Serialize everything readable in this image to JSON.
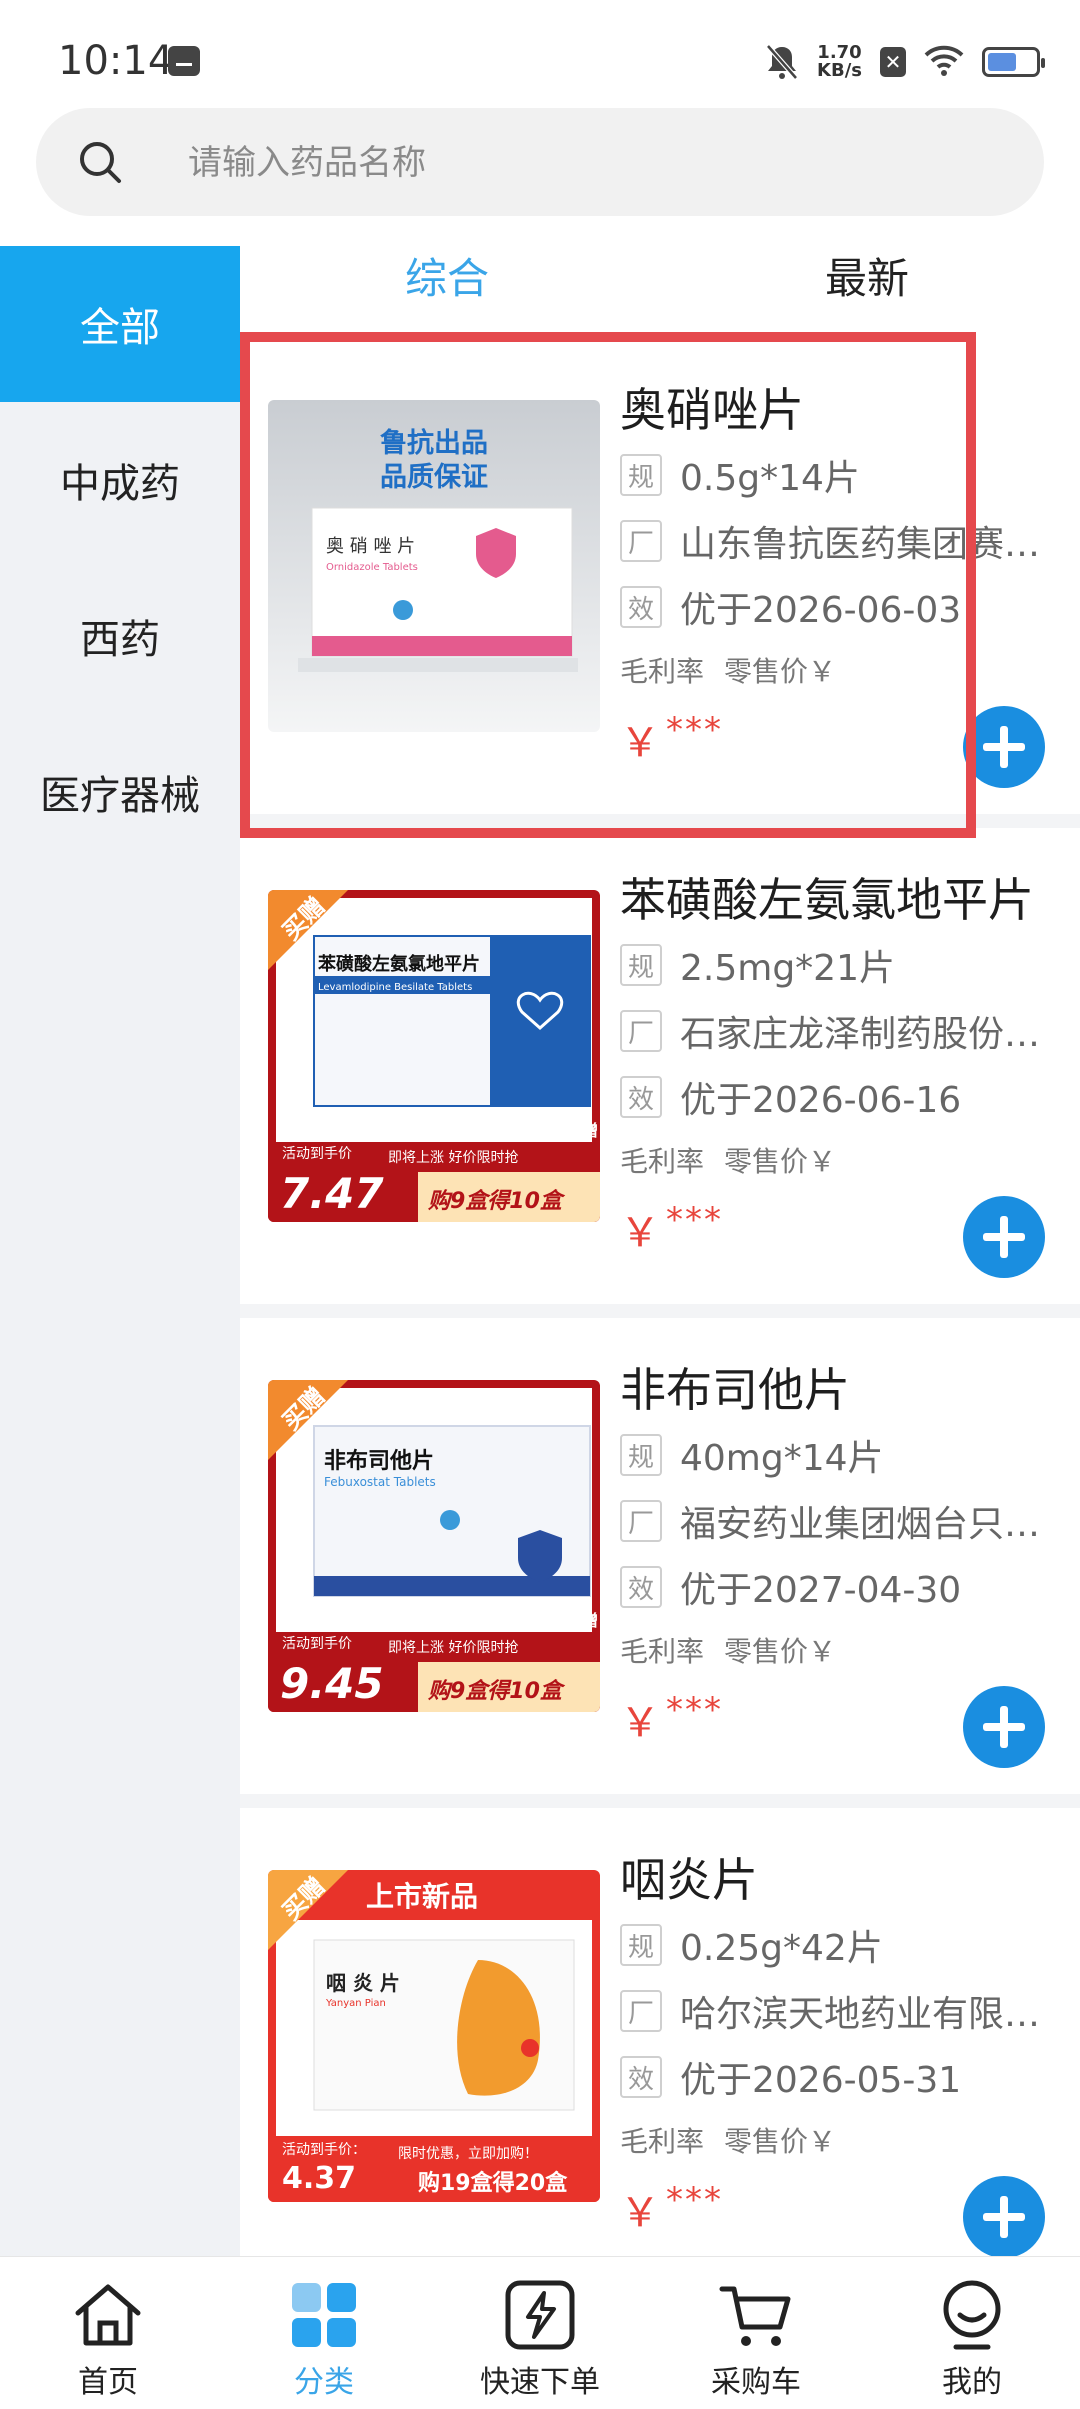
{
  "status_bar": {
    "time": "10:14",
    "net_speed_value": "1.70",
    "net_speed_unit": "KB/s",
    "icons": [
      "message-icon",
      "bell-off-icon",
      "close-box-icon",
      "wifi-icon",
      "battery-icon"
    ]
  },
  "search": {
    "placeholder": "请输入药品名称"
  },
  "sidebar": {
    "items": [
      {
        "label": "全部",
        "active": true
      },
      {
        "label": "中成药",
        "active": false
      },
      {
        "label": "西药",
        "active": false
      },
      {
        "label": "医疗器械",
        "active": false
      }
    ]
  },
  "sort_tabs": [
    {
      "label": "综合",
      "active": true
    },
    {
      "label": "最新",
      "active": false
    }
  ],
  "row_tags": {
    "spec": "规",
    "maker": "厂",
    "expiry": "效"
  },
  "products": [
    {
      "name": "奥硝唑片",
      "spec": "0.5g*14片",
      "manufacturer": "山东鲁抗医药集团赛…",
      "expiry": "优于2026-06-03",
      "margin_label": "毛利率",
      "retail_label": "零售价￥",
      "price_symbol": "￥",
      "price_hidden": "***",
      "image": {
        "banner1": "鲁抗出品",
        "banner2": "品质保证",
        "box_title": "奥 硝 唑 片",
        "box_en": "Ornidazole Tablets"
      }
    },
    {
      "name": "苯磺酸左氨氯地平片",
      "spec": "2.5mg*21片",
      "manufacturer": "石家庄龙泽制药股份…",
      "expiry": "优于2026-06-16",
      "margin_label": "毛利率",
      "retail_label": "零售价￥",
      "price_symbol": "￥",
      "price_hidden": "***",
      "image": {
        "ribbon": "买赠",
        "box_title": "苯磺酸左氨氯地平片",
        "box_en": "Levamlodipine Besilate Tablets",
        "promo_label": "活动到手价",
        "promo_price": "7.47",
        "promo_note": "即将上涨 好价限时抢",
        "gift": "满赠",
        "deal": "购9盒得10盒"
      }
    },
    {
      "name": "非布司他片",
      "spec": "40mg*14片",
      "manufacturer": "福安药业集团烟台只…",
      "expiry": "优于2027-04-30",
      "margin_label": "毛利率",
      "retail_label": "零售价￥",
      "price_symbol": "￥",
      "price_hidden": "***",
      "image": {
        "ribbon": "买赠",
        "box_title": "非布司他片",
        "box_en": "Febuxostat Tablets",
        "promo_label": "活动到手价",
        "promo_price": "9.45",
        "promo_note": "即将上涨 好价限时抢",
        "gift": "满赠",
        "deal": "购9盒得10盒"
      }
    },
    {
      "name": "咽炎片",
      "spec": "0.25g*42片",
      "manufacturer": "哈尔滨天地药业有限…",
      "expiry": "优于2026-05-31",
      "margin_label": "毛利率",
      "retail_label": "零售价￥",
      "price_symbol": "￥",
      "price_hidden": "***",
      "image": {
        "ribbon": "买赠",
        "top_banner": "上市新品",
        "box_title": "咽 炎 片",
        "box_en": "Yanyan Pian",
        "promo_label": "活动到手价：",
        "promo_price": "4.37",
        "promo_note": "限时优惠，立即加购！",
        "deal": "购19盒得20盒"
      }
    }
  ],
  "bottom_nav": [
    {
      "label": "首页",
      "icon": "home-icon",
      "active": false
    },
    {
      "label": "分类",
      "icon": "category-icon",
      "active": true
    },
    {
      "label": "快速下单",
      "icon": "quick-order-icon",
      "active": false
    },
    {
      "label": "采购车",
      "icon": "cart-icon",
      "active": false
    },
    {
      "label": "我的",
      "icon": "profile-icon",
      "active": false
    }
  ],
  "colors": {
    "accent": "#17a6ee",
    "price": "#e8453c",
    "add_button": "#1a8ee0",
    "highlight": "#e5494d"
  }
}
